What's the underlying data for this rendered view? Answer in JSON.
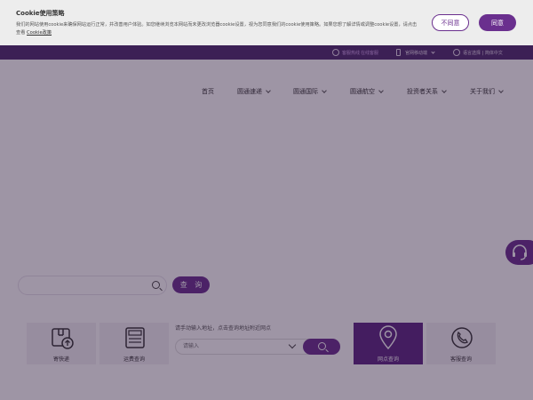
{
  "cookie": {
    "title": "Cookie使用策略",
    "text_part1": "我们的网站使用cookie来确保网站运行正常，并改善用户体验。如您继续浏览本网站而未更改浏览器cookie设置，视为您同意我们的cookie使用策略。如果您想了解详情或调整cookie设置，请点击查看",
    "link_label": "Cookie政策",
    "decline_label": "不同意",
    "accept_label": "同意"
  },
  "topbar": {
    "service": "客服热线",
    "service_hl": "在线客服",
    "mobile": "官网移动端",
    "language": "语言选择 | 简体中文"
  },
  "nav": {
    "items": [
      {
        "label": "首页"
      },
      {
        "label": "圆通速递"
      },
      {
        "label": "圆通国际"
      },
      {
        "label": "圆通航空"
      },
      {
        "label": "投资者关系"
      },
      {
        "label": "关于我们"
      }
    ]
  },
  "search": {
    "placeholder": "",
    "button_label": "查 询"
  },
  "address": {
    "hint": "请手动输入地址，点击查询地址附近网点",
    "placeholder": "请输入"
  },
  "tiles": [
    {
      "label": "寄快递",
      "icon": "package-icon"
    },
    {
      "label": "运费查询",
      "icon": "calculator-icon"
    },
    {
      "label": "网点查询",
      "icon": "location-pin-icon"
    },
    {
      "label": "客服查询",
      "icon": "phone-icon"
    }
  ],
  "colors": {
    "brand": "#6a2f8e",
    "topbar": "#4d2a6d"
  }
}
